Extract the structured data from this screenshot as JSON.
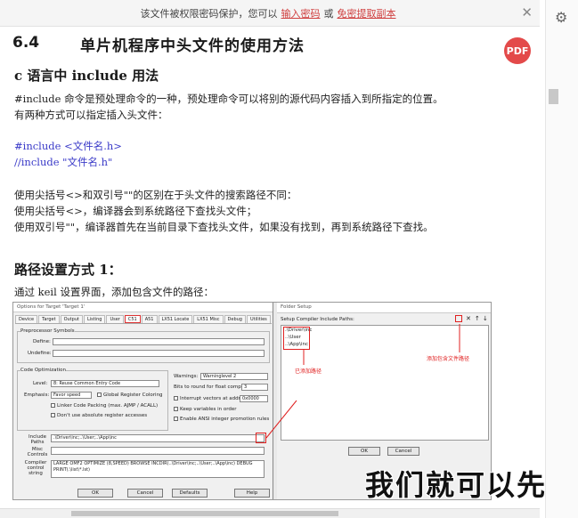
{
  "notice": {
    "text": "该文件被权限密码保护，您可以",
    "link1": "输入密码",
    "or": "或",
    "link2": "免密提取副本"
  },
  "doc": {
    "section_number": "6.4",
    "section_title": "单片机程序中头文件的使用方法",
    "pdf_badge": "PDF",
    "h_include": "c 语言中 include 用法",
    "p1": "#include 命令是预处理命令的一种，预处理命令可以将别的源代码内容插入到所指定的位置。",
    "p2": "有两种方式可以指定插入头文件：",
    "code1": "#include <文件名.h>",
    "code2": "//include \"文件名.h\"",
    "p3": "使用尖括号<>和双引号\"\"的区别在于头文件的搜索路径不同：",
    "p4": "使用尖括号<>，编译器会到系统路径下查找头文件；",
    "p5": "使用双引号\"\"，编译器首先在当前目录下查找头文件，如果没有找到，再到系统路径下查找。",
    "h_path": "路径设置方式 1：",
    "p6": "通过 keil 设置界面，添加包含文件的路径："
  },
  "figure": {
    "dlg1_title": "Options for Target 'Target 1'",
    "tabs": [
      "Device",
      "Target",
      "Output",
      "Listing",
      "User",
      "C51",
      "A51",
      "LX51 Locate",
      "LX51 Misc",
      "Debug",
      "Utilities"
    ],
    "preprocessor": "Preprocessor Symbols",
    "define": "Define:",
    "undefine": "Undefine:",
    "code_opt": "Code Optimization",
    "level": "Level:",
    "level_val": "8: Reuse Common Entry Code",
    "emphasis": "Emphasis:",
    "emphasis_val": "Favor speed",
    "global_reg": "Global Register Coloring",
    "linker_code": "Linker Code Packing (max. AJMP / ACALL)",
    "dont_abs": "Don't use absolute register accesses",
    "warnings": "Warnings:",
    "warnings_val": "Warninglevel 2",
    "bits_round": "Bits to round for float compare:",
    "bits_val": "3",
    "interrupt": "Interrupt vectors at address:",
    "interrupt_val": "0x0000",
    "keep_vars": "Keep variables in order",
    "ansi": "Enable ANSI integer promotion rules",
    "include_paths": "Include Paths",
    "include_val": ".\\Driver\\inc;..\\User;..\\App\\inc",
    "misc_controls": "Misc Controls",
    "compiler_string": "Compiler control string",
    "compiler_val": "LARGE OMF2 OPTIMIZE (8,SPEED) BROWSE INCDIR(..\\Driver\\inc;..\\User;..\\App\\inc) DEBUG PRINT(.\\list\\*.lst)",
    "btn_ok": "OK",
    "btn_cancel": "Cancel",
    "btn_defaults": "Defaults",
    "btn_help": "Help",
    "dlg2_title": "Folder Setup",
    "setup_label": "Setup Compiler Include Paths:",
    "paths": [
      ".\\Driver\\inc",
      "..\\User",
      "..\\App\\inc"
    ],
    "added_label": "已添加路径",
    "add_label": "添加包含文件路径",
    "ok2": "OK",
    "cancel2": "Cancel"
  },
  "overlay_text": "我们就可以先"
}
